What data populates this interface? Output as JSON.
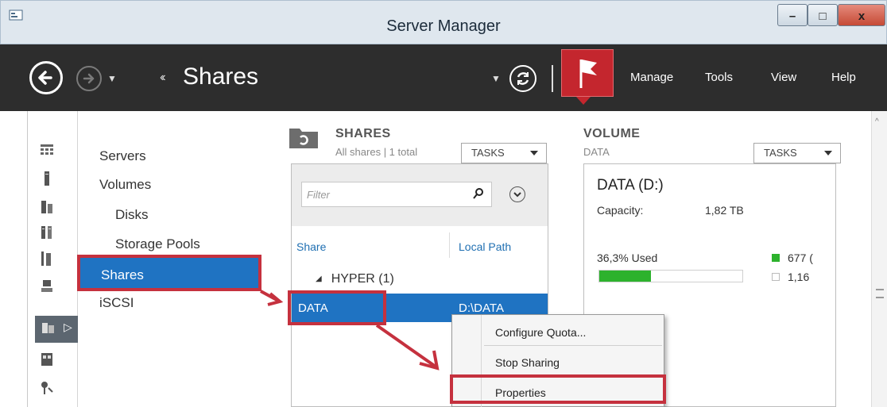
{
  "window": {
    "title": "Server Manager",
    "minimize_glyph": "–",
    "maximize_glyph": "□",
    "close_glyph": "x"
  },
  "toolbar": {
    "breadcrumb_arrows": "‹‹",
    "breadcrumb": "Shares",
    "menu": [
      "Manage",
      "Tools",
      "View",
      "Help"
    ]
  },
  "nav": {
    "items": [
      "Servers",
      "Volumes",
      "Disks",
      "Storage Pools",
      "Shares",
      "iSCSI"
    ],
    "active_item": "Shares"
  },
  "shares": {
    "title": "SHARES",
    "subtitle": "All shares | 1 total",
    "tasks_label": "TASKS",
    "filter_placeholder": "Filter",
    "columns": [
      "Share",
      "Local Path"
    ],
    "group": "HYPER (1)",
    "rows": [
      {
        "share": "DATA",
        "local_path": "D:\\DATA"
      }
    ]
  },
  "volume": {
    "title": "VOLUME",
    "subtitle": "DATA",
    "tasks_label": "TASKS",
    "name": "DATA (D:)",
    "capacity_label": "Capacity:",
    "capacity_value": "1,82 TB",
    "used_label": "36,3% Used",
    "used_fraction": 0.363,
    "legend": [
      {
        "value": "677 (",
        "color": "#2db22d"
      },
      {
        "value": "1,16",
        "color": "#ffffff"
      }
    ]
  },
  "context_menu": {
    "items": [
      "Configure Quota...",
      "Stop Sharing",
      "Properties"
    ]
  },
  "colors": {
    "accent": "#1f73c2",
    "annotation": "#c5313e",
    "toolbar": "#2d2d2d",
    "notification": "#c4262e"
  },
  "icons": {
    "app": "server-manager-icon",
    "back": "back-arrow-icon",
    "forward": "forward-arrow-icon",
    "refresh": "refresh-icon",
    "flag": "notifications-flag-icon"
  }
}
